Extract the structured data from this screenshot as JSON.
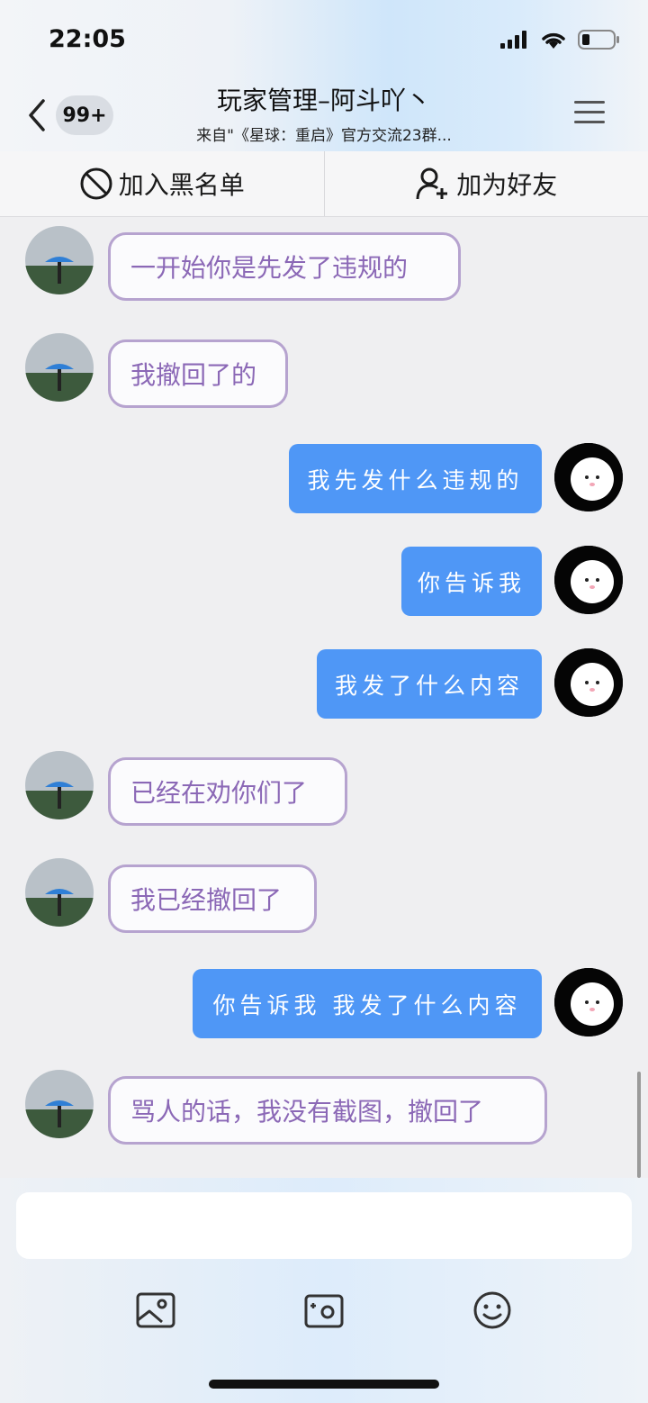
{
  "status": {
    "time": "22:05"
  },
  "header": {
    "badge": "99+",
    "title": "玩家管理–阿斗吖丶",
    "subtitle": "来自\"《星球：重启》官方交流23群..."
  },
  "actions": {
    "block_label": "加入黑名单",
    "add_friend_label": "加为好友"
  },
  "messages": [
    {
      "side": "other",
      "text": "一开始你是先发了违规的"
    },
    {
      "side": "other",
      "text": "我撤回了的"
    },
    {
      "side": "me",
      "text": "我先发什么违规的"
    },
    {
      "side": "me",
      "text": "你告诉我"
    },
    {
      "side": "me",
      "text": "我发了什么内容"
    },
    {
      "side": "other",
      "text": "已经在劝你们了"
    },
    {
      "side": "other",
      "text": "我已经撤回了"
    },
    {
      "side": "me",
      "text": "你告诉我 我发了什么内容"
    },
    {
      "side": "other",
      "text": "骂人的话，我没有截图，撤回了"
    }
  ],
  "composer": {
    "input_value": ""
  },
  "icons": {
    "back": "chevron-left-icon",
    "menu": "hamburger-menu-icon",
    "block": "block-icon",
    "add_friend": "add-user-icon",
    "image": "image-icon",
    "camera": "camera-icon",
    "emoji": "emoji-icon"
  },
  "colors": {
    "my_bubble": "#4f97f6",
    "other_bubble_border": "#b6a3cf",
    "other_bubble_text": "#8b68b6"
  }
}
